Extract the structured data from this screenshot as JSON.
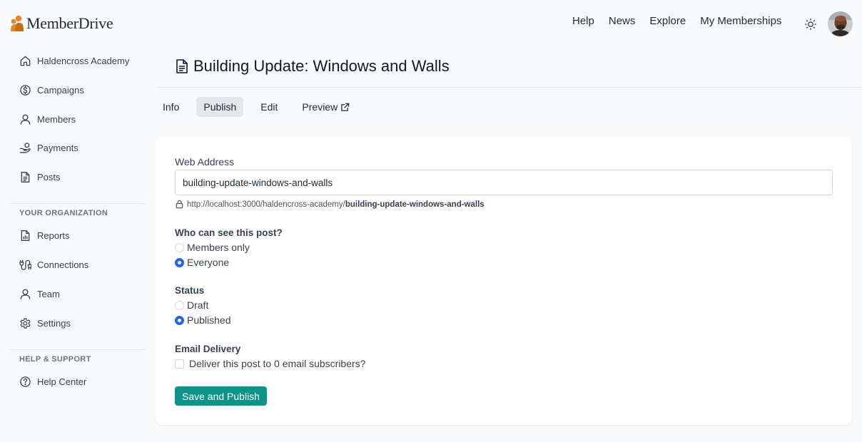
{
  "app": {
    "brand": "MemberDrive"
  },
  "topnav": {
    "items": [
      "Help",
      "News",
      "Explore",
      "My Memberships"
    ]
  },
  "sidebar": {
    "org_name": "Haldencross Academy",
    "items": [
      {
        "label": "Campaigns",
        "icon": "dollar-circle-icon"
      },
      {
        "label": "Members",
        "icon": "user-icon"
      },
      {
        "label": "Payments",
        "icon": "hand-coin-icon"
      },
      {
        "label": "Posts",
        "icon": "document-icon"
      }
    ],
    "section_org": "YOUR ORGANIZATION",
    "org_items": [
      {
        "label": "Reports",
        "icon": "report-icon"
      },
      {
        "label": "Connections",
        "icon": "plug-icon"
      },
      {
        "label": "Team",
        "icon": "user-icon"
      },
      {
        "label": "Settings",
        "icon": "gear-icon"
      }
    ],
    "section_help": "HELP & SUPPORT",
    "help_items": [
      {
        "label": "Help Center",
        "icon": "question-circle-icon"
      }
    ]
  },
  "page": {
    "title": "Building Update: Windows and Walls",
    "tabs": [
      "Info",
      "Publish",
      "Edit",
      "Preview"
    ],
    "active_tab": "Publish"
  },
  "form": {
    "web_address_label": "Web Address",
    "web_address_value": "building-update-windows-and-walls",
    "url_prefix": "http://localhost:3000/haldencross-academy/",
    "url_slug": "building-update-windows-and-walls",
    "visibility_title": "Who can see this post?",
    "visibility_options": [
      "Members only",
      "Everyone"
    ],
    "visibility_selected": "Everyone",
    "status_title": "Status",
    "status_options": [
      "Draft",
      "Published"
    ],
    "status_selected": "Published",
    "email_title": "Email Delivery",
    "email_checkbox_label": "Deliver this post to 0 email subscribers?",
    "email_checked": false,
    "save_button": "Save and Publish"
  },
  "colors": {
    "accent": "#0d9488",
    "radio_selected": "#2563eb",
    "logo_orange": "#e8862f"
  }
}
